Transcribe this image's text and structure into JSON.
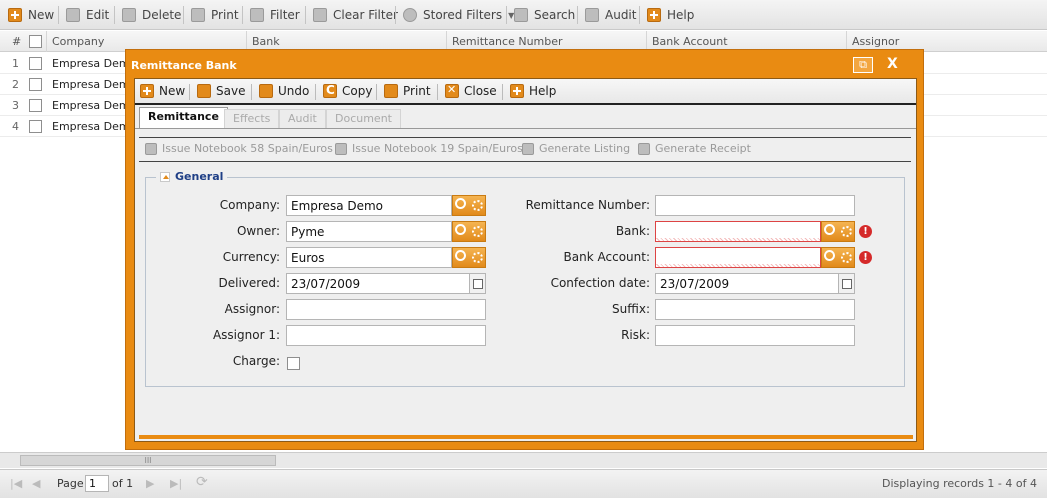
{
  "main_toolbar": {
    "new": "New",
    "edit": "Edit",
    "delete": "Delete",
    "print": "Print",
    "filter": "Filter",
    "clear_filter": "Clear Filter",
    "stored_filters": "Stored Filters",
    "search": "Search",
    "audit": "Audit",
    "help": "Help"
  },
  "grid": {
    "headers": {
      "num": "#",
      "company": "Company",
      "bank": "Bank",
      "remittance_number": "Remittance Number",
      "bank_account": "Bank Account",
      "assignor": "Assignor"
    },
    "rows": [
      {
        "num": "1",
        "company": "Empresa Demo"
      },
      {
        "num": "2",
        "company": "Empresa Demo"
      },
      {
        "num": "3",
        "company": "Empresa Demo"
      },
      {
        "num": "4",
        "company": "Empresa Demo"
      }
    ],
    "scroll_grip": "III"
  },
  "pager": {
    "page_label": "Page",
    "page_value": "1",
    "of_label": "of 1",
    "status": "Displaying records 1 - 4 of 4"
  },
  "dialog": {
    "title": "Remittance Bank",
    "restore_glyph": "⧉",
    "close_glyph": "X",
    "toolbar": {
      "new": "New",
      "save": "Save",
      "undo": "Undo",
      "copy": "Copy",
      "print": "Print",
      "close": "Close",
      "help": "Help"
    },
    "tabs": [
      "Remittance",
      "Effects",
      "Audit",
      "Document"
    ],
    "actions": [
      "Issue Notebook 58 Spain/Euros",
      "Issue Notebook 19 Spain/Euros",
      "Generate Listing",
      "Generate Receipt"
    ],
    "section": "General",
    "fields": {
      "company": {
        "label": "Company:",
        "value": "Empresa Demo"
      },
      "owner": {
        "label": "Owner:",
        "value": "Pyme"
      },
      "currency": {
        "label": "Currency:",
        "value": "Euros"
      },
      "delivered": {
        "label": "Delivered:",
        "value": "23/07/2009"
      },
      "assignor": {
        "label": "Assignor:",
        "value": ""
      },
      "assignor1": {
        "label": "Assignor 1:",
        "value": ""
      },
      "charge": {
        "label": "Charge:"
      },
      "remittance_number": {
        "label": "Remittance Number:",
        "value": ""
      },
      "bank": {
        "label": "Bank:",
        "value": ""
      },
      "bank_account": {
        "label": "Bank Account:",
        "value": ""
      },
      "confection_date": {
        "label": "Confection date:",
        "value": "23/07/2009"
      },
      "suffix": {
        "label": "Suffix:",
        "value": ""
      },
      "risk": {
        "label": "Risk:",
        "value": ""
      }
    },
    "error_glyph": "!"
  },
  "icons": {
    "toolbar_color": "#e28a1b",
    "error_color": "#d52a2a"
  }
}
